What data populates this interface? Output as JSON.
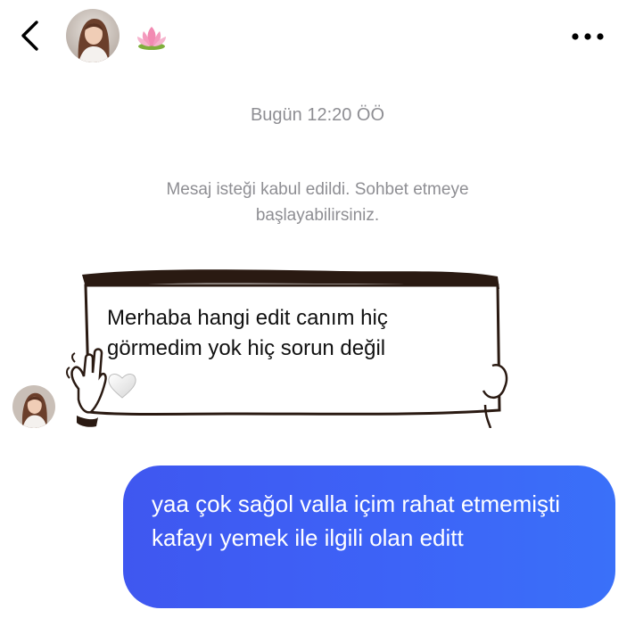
{
  "header": {
    "back_icon": "chevron-left-icon",
    "avatar_icon": "profile-photo",
    "lotus_emoji": "🪷",
    "more_icon": "more-horizontal-icon"
  },
  "thread": {
    "timestamp": "Bugün 12:20 ÖÖ",
    "system_message": "Mesaj isteği kabul edildi. Sohbet etmeye başlayabilirsiniz.",
    "incoming": {
      "text": "Merhaba hangi edit canım hiç görmedim yok hiç sorun değil",
      "emoji": "🤍"
    },
    "outgoing": {
      "text": "yaa çok sağol valla içim rahat etmemişti kafayı yemek ile ilgili olan editt"
    }
  },
  "colors": {
    "outgoing_bubble_start": "#3f57f0",
    "outgoing_bubble_end": "#3a70f9",
    "meta_text": "#8e8e93",
    "sticker_ink": "#2a1a12"
  }
}
